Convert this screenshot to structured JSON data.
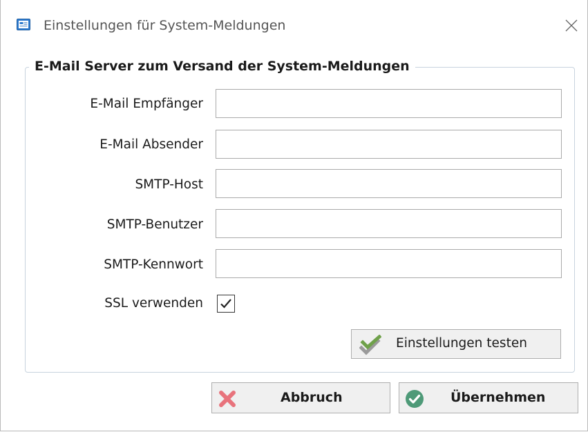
{
  "window": {
    "title": "Einstellungen für System-Meldungen",
    "app_icon": "dialog-settings-icon",
    "close_icon": "close-icon"
  },
  "group": {
    "title": "E-Mail Server zum Versand der System-Meldungen"
  },
  "fields": {
    "recipient": {
      "label": "E-Mail Empfänger",
      "value": ""
    },
    "sender": {
      "label": "E-Mail Absender",
      "value": ""
    },
    "smtp_host": {
      "label": "SMTP-Host",
      "value": ""
    },
    "smtp_user": {
      "label": "SMTP-Benutzer",
      "value": ""
    },
    "smtp_password": {
      "label": "SMTP-Kennwort",
      "value": ""
    }
  },
  "ssl": {
    "label": "SSL verwenden",
    "checked": true
  },
  "buttons": {
    "test": {
      "label": "Einstellungen testen",
      "icon": "double-check-icon"
    },
    "cancel": {
      "label": "Abbruch",
      "icon": "red-x-icon"
    },
    "apply": {
      "label": "Übernehmen",
      "icon": "green-check-circle-icon"
    }
  },
  "colors": {
    "cancel_icon": "#e8737c",
    "apply_icon": "#4e9a78",
    "test_icon_front": "#6fa14a",
    "test_icon_back": "#9a9a9a",
    "group_border": "#c7d3de"
  }
}
